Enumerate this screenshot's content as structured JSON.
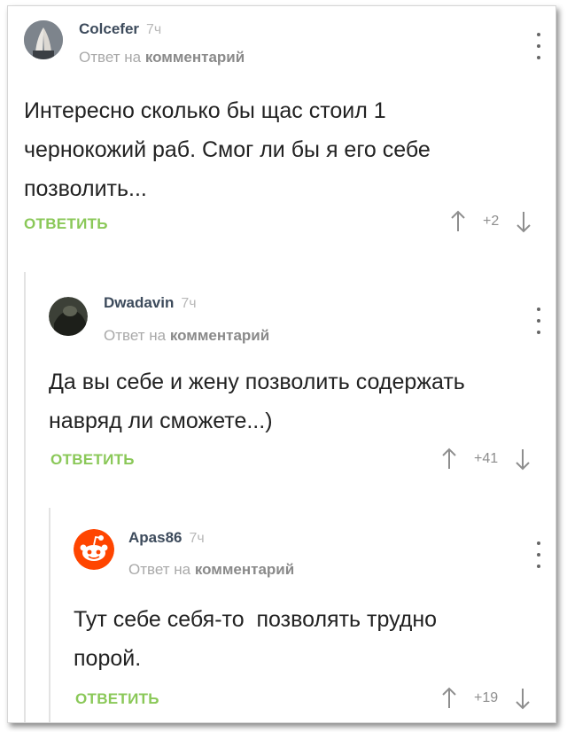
{
  "comments": [
    {
      "username": "Colcefer",
      "time": "7ч",
      "reply_prefix": "Ответ на",
      "reply_link": "комментарий",
      "text_lines": [
        "Интересно сколько бы щас стоил 1",
        "чернокожий раб. Смог ли бы я его себе",
        "позволить..."
      ],
      "reply_label": "ОТВЕТИТЬ",
      "score": "+2",
      "avatar_icon": "praying-hands-icon"
    },
    {
      "username": "Dwadavin",
      "time": "7ч",
      "reply_prefix": "Ответ на",
      "reply_link": "комментарий",
      "text_lines": [
        "Да вы себе и жену позволить содержать",
        "навряд ли сможете...)"
      ],
      "reply_label": "ОТВЕТИТЬ",
      "score": "+41",
      "avatar_icon": "dark-photo-icon"
    },
    {
      "username": "Apas86",
      "time": "7ч",
      "reply_prefix": "Ответ на",
      "reply_link": "комментарий",
      "text_lines": [
        "Тут себе себя-то  позволять трудно",
        "порой."
      ],
      "reply_label": "ОТВЕТИТЬ",
      "score": "+19",
      "avatar_icon": "reddit-alien-icon"
    }
  ],
  "colors": {
    "reply_green": "#8ac858",
    "username": "#3d4b5c",
    "muted": "#a9a9a9",
    "reddit_orange": "#ff4500"
  }
}
